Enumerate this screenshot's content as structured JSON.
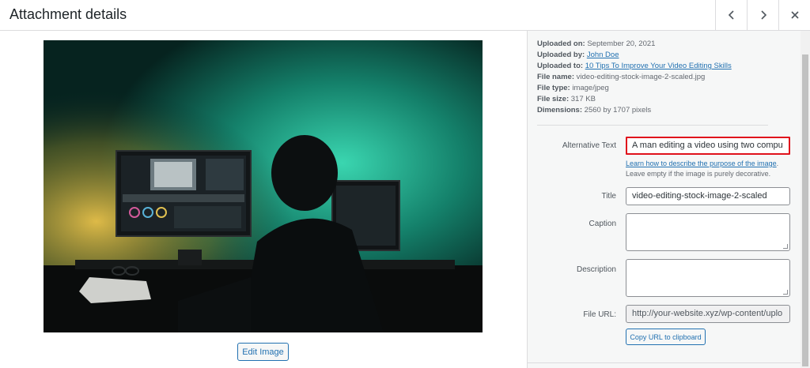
{
  "header": {
    "title": "Attachment details",
    "prev_icon": "chevron-left-icon",
    "next_icon": "chevron-right-icon",
    "close_icon": "close-icon"
  },
  "preview": {
    "edit_button": "Edit Image"
  },
  "meta": {
    "uploaded_on_label": "Uploaded on:",
    "uploaded_on": "September 20, 2021",
    "uploaded_by_label": "Uploaded by:",
    "uploaded_by": "John Doe",
    "uploaded_to_label": "Uploaded to:",
    "uploaded_to": "10 Tips To Improve Your Video Editing Skills",
    "file_name_label": "File name:",
    "file_name": "video-editing-stock-image-2-scaled.jpg",
    "file_type_label": "File type:",
    "file_type": "image/jpeg",
    "file_size_label": "File size:",
    "file_size": "317 KB",
    "dimensions_label": "Dimensions:",
    "dimensions": "2560 by 1707 pixels"
  },
  "form": {
    "alt_label": "Alternative Text",
    "alt_value": "A man editing a video using two compu",
    "alt_help_link": "Learn how to describe the purpose of the image",
    "alt_help_link_suffix": ".",
    "alt_help_text": "Leave empty if the image is purely decorative.",
    "title_label": "Title",
    "title_value": "video-editing-stock-image-2-scaled",
    "caption_label": "Caption",
    "description_label": "Description",
    "file_url_label": "File URL:",
    "file_url_value": "http://your-website.xyz/wp-content/uplo",
    "copy_url_button": "Copy URL to clipboard"
  },
  "colors": {
    "accent": "#2271b1",
    "highlight_border": "#e0121c"
  }
}
